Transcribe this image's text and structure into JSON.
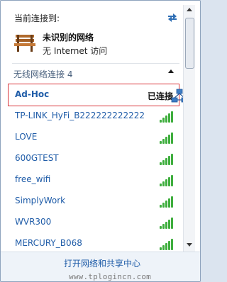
{
  "header": {
    "title": "当前连接到:",
    "current_network": {
      "name": "未识别的网络",
      "status": "无 Internet 访问",
      "icon": "bench-icon"
    },
    "refresh_icon": "refresh-icon"
  },
  "group": {
    "label": "无线网络连接 4",
    "collapse_icon": "chevron-up-icon"
  },
  "connected_network": {
    "name": "Ad-Hoc",
    "status": "已连接",
    "icon": "adhoc-network-icon"
  },
  "networks": [
    {
      "name": "TP-LINK_HyFi_B222222222222",
      "signal": 5
    },
    {
      "name": "LOVE",
      "signal": 5
    },
    {
      "name": "600GTEST",
      "signal": 5
    },
    {
      "name": "free_wifi",
      "signal": 5
    },
    {
      "name": "SimplyWork",
      "signal": 5
    },
    {
      "name": "WVR300",
      "signal": 5
    },
    {
      "name": "MERCURY_B068",
      "signal": 5
    }
  ],
  "footer": {
    "link": "打开网络和共享中心"
  },
  "watermark": "www.tplogincn.com",
  "colors": {
    "link": "#1f5ca8",
    "highlight_border": "#d9353a",
    "signal": "#3fae3e"
  }
}
